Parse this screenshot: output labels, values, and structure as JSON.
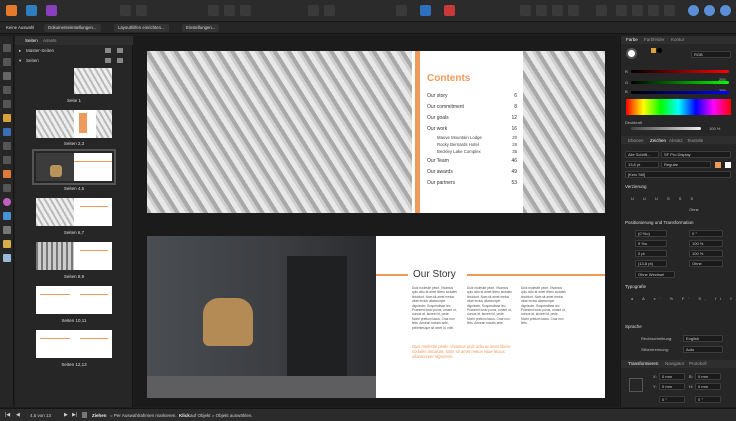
{
  "context_toolbar": {
    "no_selection": "Keine Auswahl",
    "doc_settings": "Dokumenteinstellungen...",
    "layout_guides": "Layouthilfen einrichten...",
    "preferences": "Einstellungen..."
  },
  "pages_panel": {
    "tab_pages": "Seiten",
    "tab_assets": "Assets",
    "master_pages": "Master-Seiten",
    "pages": "Seiten",
    "thumbs": [
      "Seite 1",
      "Seiten 2,3",
      "Seiten 4,5",
      "Seiten 6,7",
      "Seiten 8,9",
      "Seiten 10,11",
      "Seiten 12,13"
    ]
  },
  "toc": {
    "title": "Contents",
    "entries": [
      {
        "label": "Our story",
        "page": "6"
      },
      {
        "label": "Our commitment",
        "page": "8"
      },
      {
        "label": "Our goals",
        "page": "12"
      },
      {
        "label": "Our work",
        "page": "16"
      }
    ],
    "sub_entries": [
      {
        "label": "Mauve Mountain Lodge",
        "page": "20"
      },
      {
        "label": "Rocky Bernards Hotel",
        "page": "28"
      },
      {
        "label": "Beckley Lake Complex",
        "page": "35"
      }
    ],
    "entries2": [
      {
        "label": "Our Team",
        "page": "46"
      },
      {
        "label": "Our awards",
        "page": "49"
      },
      {
        "label": "Our partners",
        "page": "53"
      }
    ]
  },
  "story": {
    "title": "Our Story",
    "quote": "Duis molestie pede. Vivamus quis odio at amet libero sodales tincidunt. Nam sit amet metus vitae lectus ullamcorper dignissim."
  },
  "right_panel": {
    "tab_color": "Farbe",
    "tab_swatches": "Farbfelder",
    "tab_stroke": "Kontur",
    "mode": "RGB",
    "r": "255",
    "g": "255",
    "b": "255",
    "opacity_label": "Deckkraft",
    "opacity": "100 %",
    "tab_layers": "Ebenen",
    "tab_char": "Zeichen",
    "tab_para": "Absatz",
    "tab_textstyles": "Textstile",
    "font_scope": "Alle Schrift...",
    "font": "SF Pro Display",
    "size": "13,8 pt",
    "weight": "Regular",
    "style": "[Kein Stil]",
    "decoration": "Verzierung",
    "none": "Ohne",
    "position": "Positionierung und Transformation",
    "kern": "(0 %o)",
    "track": "9 %o",
    "baseline": "0 pt",
    "leading": "(13,8 pt)",
    "angle": "0 °",
    "hscale": "100 %",
    "vscale": "100 %",
    "ohne2": "Ohne",
    "ohne_wechsel": "Ohne Wechsel",
    "typography": "Typografie",
    "language": "Sprache",
    "spell_label": "Rechtschreibung:",
    "spell": "English",
    "hyph_label": "Silbentrennung:",
    "hyph": "Auto",
    "tab_transform": "Transformieren",
    "tab_nav": "Navigator",
    "tab_history": "Protokoll",
    "x": "0 mm",
    "y": "0 mm",
    "w": "0 mm",
    "h": "0 mm",
    "r_angle": "0 °",
    "s_angle": "0 °"
  },
  "status": {
    "page": "4,5 von 13",
    "hint_drag": "Ziehen",
    "hint1": "= Per Auswahlrahmen markieren.",
    "hint_click": "Klick",
    "hint2": "auf Objekt = Objekt auswählen."
  },
  "colors": {
    "accent": "#ee9a5a",
    "toc_bg": "#ee9a5a"
  }
}
